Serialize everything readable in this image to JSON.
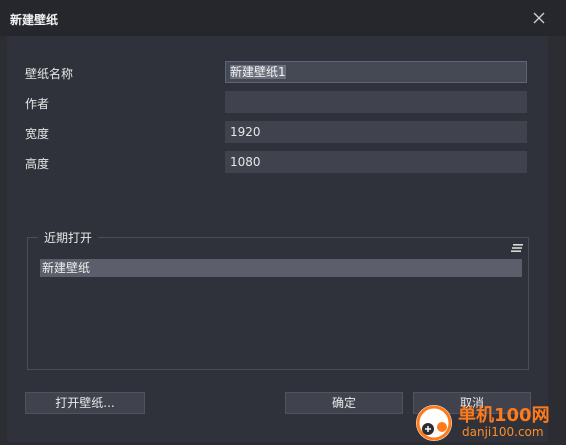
{
  "window": {
    "title": "新建壁纸"
  },
  "fields": [
    {
      "label": "壁纸名称",
      "value": "新建壁纸1"
    },
    {
      "label": "作者",
      "value": ""
    },
    {
      "label": "宽度",
      "value": "1920"
    },
    {
      "label": "高度",
      "value": "1080"
    }
  ],
  "recent": {
    "title": "近期打开",
    "items": [
      "新建壁纸"
    ]
  },
  "buttons": {
    "open": "打开壁纸...",
    "ok": "确定",
    "cancel": "取消"
  },
  "watermark": {
    "site": "单机100网",
    "url": "danji100.com"
  }
}
